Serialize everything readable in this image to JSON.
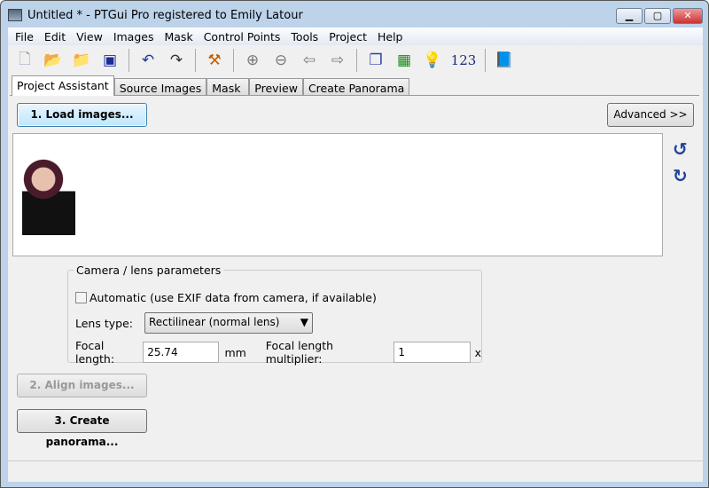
{
  "window": {
    "title": "Untitled * - PTGui Pro registered to Emily Latour",
    "minimize": "▁",
    "maximize": "▢",
    "close": "✕"
  },
  "menu": [
    "File",
    "Edit",
    "View",
    "Images",
    "Mask",
    "Control Points",
    "Tools",
    "Project",
    "Help"
  ],
  "toolbar": {
    "numbers_label": "123"
  },
  "tabs": [
    "Project Assistant",
    "Source Images",
    "Mask",
    "Preview",
    "Create Panorama"
  ],
  "buttons": {
    "load": "1. Load images...",
    "advanced": "Advanced >>",
    "align": "2. Align images...",
    "create": "3. Create panorama..."
  },
  "icons": {
    "rotate_left": "↺",
    "rotate_right": "↻"
  },
  "camera": {
    "legend": "Camera / lens parameters",
    "automatic_label": "Automatic (use EXIF data from camera, if available)",
    "automatic_checked": false,
    "lens_type_label": "Lens type:",
    "lens_type_value": "Rectilinear (normal lens)",
    "focal_length_label": "Focal length:",
    "focal_length_value": "25.74",
    "focal_unit": "mm",
    "multiplier_label": "Focal length multiplier:",
    "multiplier_value": "1",
    "multiplier_unit": "x"
  }
}
